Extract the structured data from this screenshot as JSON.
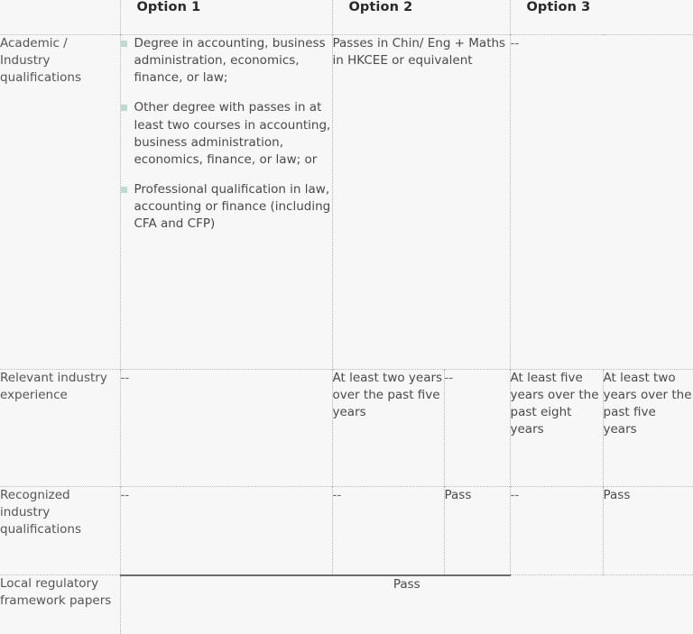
{
  "table": {
    "corner_label": "",
    "columns": [
      {
        "label": "Option 1"
      },
      {
        "label": "Option 2"
      },
      {
        "label": "Option 3"
      }
    ],
    "accent_header_bg": "#dcf0ec",
    "cell_bg": "#f7f7f7",
    "bullet_color": "#b9ddd3",
    "divider_color": "#b3b3b3",
    "text_color": "#4a4a4a",
    "rows": [
      {
        "header": "Academic / Industry qualifications",
        "option1": {
          "type": "bullets",
          "items": [
            "Degree in accounting, business administration, economics, finance, or law;",
            "Other degree with passes in at least two courses in accounting, business administration, economics, finance, or law; or",
            "Professional qualification in law, accounting or finance (including CFA and CFP)"
          ]
        },
        "option2a": "Passes in Chin/ Eng + Maths in HKCEE or equivalent",
        "option3a": "--"
      },
      {
        "header": "Relevant industry experience",
        "option1": "--",
        "option2a": "At least two years over the past five years",
        "option2b": "--",
        "option3a": "At least five years over the past eight years",
        "option3b": "At least two years over the past five years"
      },
      {
        "header": "Recognized industry qualifications",
        "option1": "--",
        "option2a": "--",
        "option2b": "Pass",
        "option3a": "--",
        "option3b": "Pass"
      },
      {
        "header": "Local regulatory framework papers",
        "spanned_value": "Pass"
      }
    ]
  }
}
